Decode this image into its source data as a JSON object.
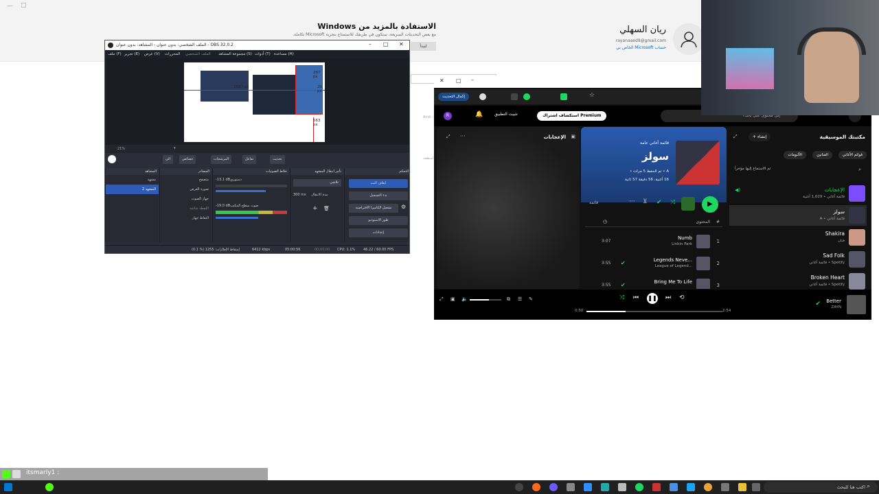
{
  "settings": {
    "heading": "الاستفادة بالمزيد من Windows",
    "sub": "مع بعض التحديثات السريعة، ستكون في طريقك للاستمتاع بتجربة Microsoft تكاملة.",
    "button_label": "لنبدأ",
    "user_name": "ريان السهلي",
    "user_email": "rayanaaed9@gmail.com",
    "user_link": "حساب Microsoft الخاص بي",
    "ghost_1": "Andr",
    "ghost_2": "لمنطقة"
  },
  "obs": {
    "title": "الملف الشخصي: بدون عنوان - المشاهد: بدون عنوان - OBS 32.0.2",
    "menu": [
      "ملف (F)",
      "تحرير (E)",
      "عرض (V)",
      "المحررات",
      "الملف الشخصي",
      "مجموعة المشاهد (S)",
      "أدوات (T)",
      "مساعدة (H)"
    ],
    "canvas_labels": [
      "1587 px",
      "267 px",
      "29 px",
      "563 px"
    ],
    "zoom": "21%",
    "toolbar_buttons": [
      "تحديث",
      "تفاعل",
      "المرشحات",
      "خصائص",
      "الي"
    ],
    "docks": {
      "scenes_title": "المشاهد",
      "scenes": [
        "مشهد",
        "المشهد 2"
      ],
      "sources_title": "المصادر",
      "sources": [
        "متصفح",
        "صورة العرض",
        "جهاز الصوت",
        "اللقطة شاشة",
        "التقاط جهاز"
      ],
      "mixer_title": "خلاط الصوتيات",
      "mixer": [
        {
          "name": "دستوري",
          "db": "-13.1 dB"
        },
        {
          "name": "صوت سطح المكتب",
          "db": "-19.0 dB"
        }
      ],
      "transitions_title": "تأثير انتقال المشهد",
      "transition_value": "تلاشي",
      "duration_label": "مدة الانتقال",
      "duration_value": "300 ms",
      "controls_title": "التحكم",
      "controls": [
        "ايقاف البث",
        "بدء التسجيل",
        "تشغيل الكاميرا الافتراضية",
        "طور الاستوديو",
        "إعدادات"
      ]
    },
    "status": {
      "dropped": "(0.1 %) 1255 :إسقاط الإطارات",
      "bitrate": "6412 kbps",
      "stream_time": "05:00:56",
      "rec_time": "00:00:00",
      "cpu": "CPU: 1.1%",
      "fps": "46.22 / 60.00 FPS"
    }
  },
  "spotify": {
    "install_label": "تثبيت التطبيق",
    "premium_label": "استكشاف اشتراك Premium",
    "search_placeholder": "إلى محتوى على بالك؟",
    "update_label": "إكمال التحديث",
    "library": {
      "title": "مكتبتك الموسيقية",
      "create": "إنشاء",
      "filters": [
        "قوائم الأغاني",
        "الفنانين",
        "الألبومات"
      ],
      "sort_label": "تم الاستماع إليها مؤخراً",
      "items": [
        {
          "title": "الإعجابات",
          "sub": "قائمة أغاني • 1,029 أغنية",
          "color": "#7a4dff"
        },
        {
          "title": "سولز",
          "sub": "قائمة أغاني • A",
          "color": "#334"
        },
        {
          "title": "Shakira",
          "sub": "فنان",
          "color": "#c98"
        },
        {
          "title": "Sad Folk",
          "sub": "Spotify • قائمة أغاني",
          "color": "#556"
        },
        {
          "title": "Broken Heart",
          "sub": "Spotify • قائمة أغاني",
          "color": "#889"
        }
      ]
    },
    "playlist": {
      "type_label": "قائمة أغاني عامة",
      "title": "سولز",
      "meta": "A • تم الحفظ 5 مرات •",
      "meta2": "16 أغنية، 56 دقيقة 57 ثانية",
      "list_label": "قائمة",
      "col_hash": "#",
      "col_title": "المحتوى",
      "tracks": [
        {
          "num": "1",
          "title": "Numb",
          "artist": "Linkin Park",
          "duration": "3:07",
          "liked": false
        },
        {
          "num": "2",
          "title": "Legends Neve...",
          "artist": "League of Legend...",
          "duration": "3:55",
          "liked": true
        },
        {
          "num": "3",
          "title": "Bring Me To Life",
          "artist": "",
          "duration": "3:55",
          "liked": true
        }
      ]
    },
    "panel_title": "الإعجابات",
    "now_playing": {
      "title": "Better",
      "artist": "ZAYN",
      "elapsed": "0:50",
      "total": "2:54",
      "progress": 0.29,
      "volume": 0.6
    }
  },
  "chat": {
    "name": "itsmarly1 :"
  },
  "taskbar": {
    "search_placeholder": "اكتب هنا للبحث"
  }
}
